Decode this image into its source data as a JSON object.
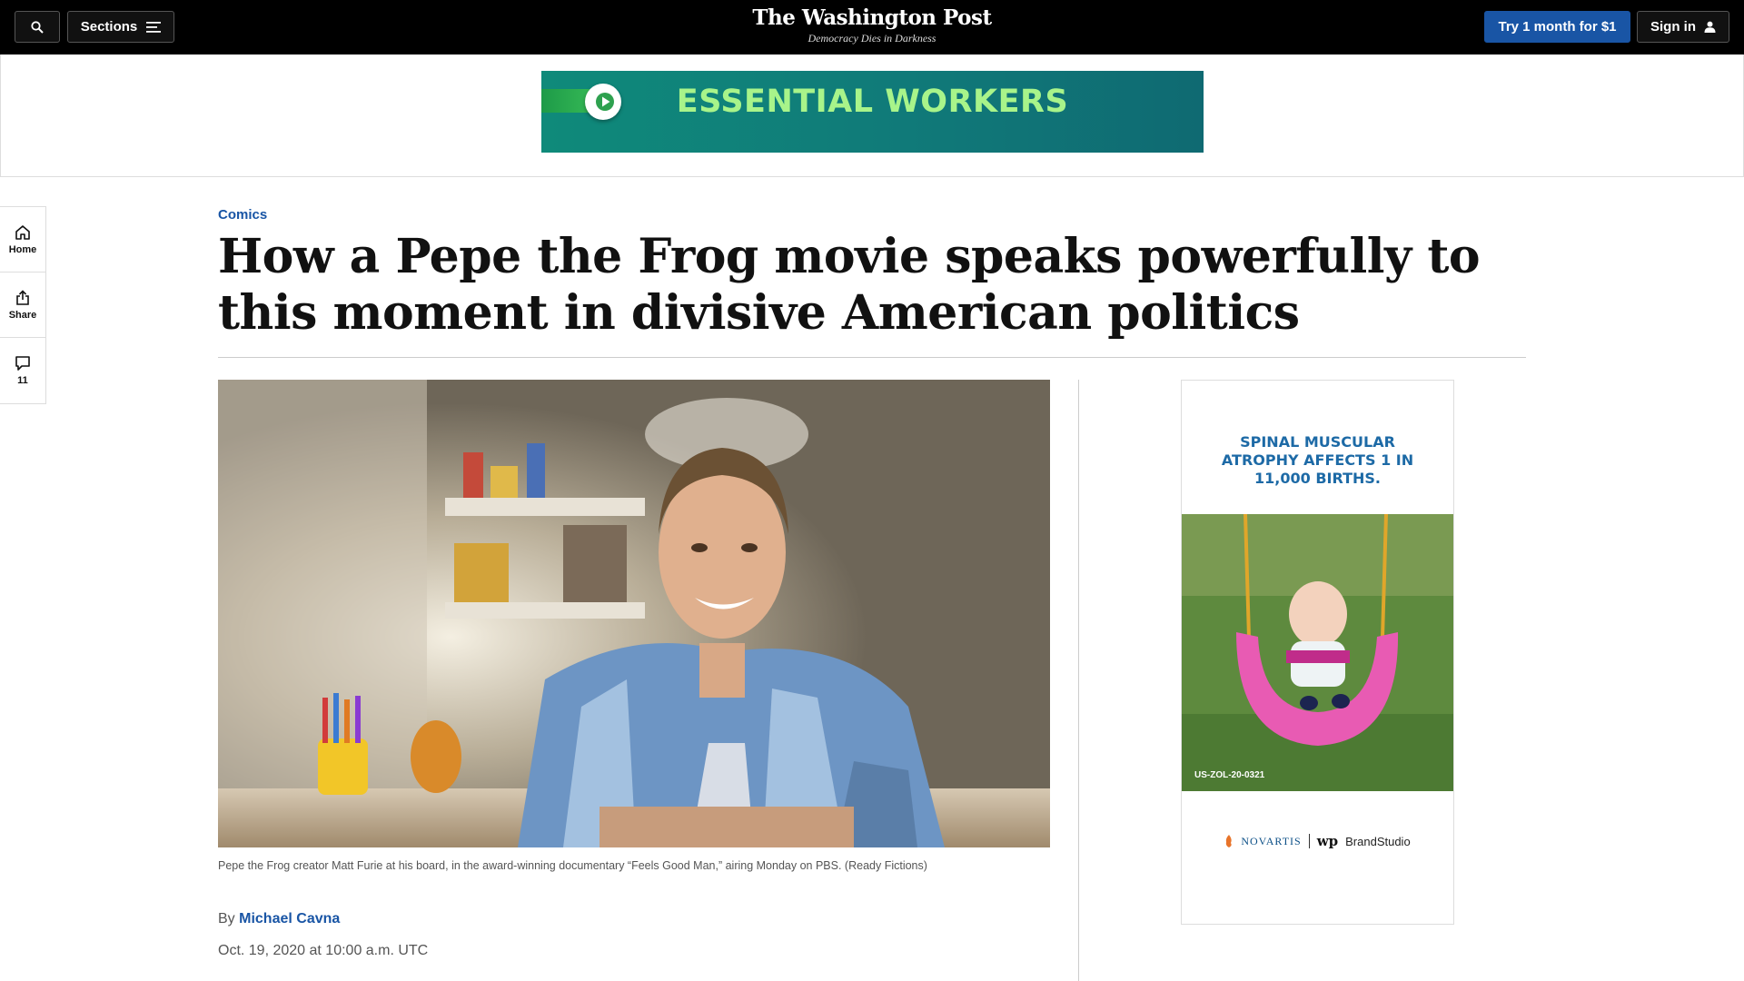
{
  "nav": {
    "sections_label": "Sections",
    "logo": "The Washington Post",
    "tagline": "Democracy Dies in Darkness",
    "subscribe_label": "Try 1 month for $1",
    "signin_label": "Sign in"
  },
  "top_ad": {
    "text": "ESSENTIAL WORKERS"
  },
  "left_rail": {
    "home_label": "Home",
    "share_label": "Share",
    "comments_count": "11"
  },
  "article": {
    "kicker": "Comics",
    "headline": "How a Pepe the Frog movie speaks powerfully to this moment in divisive American politics",
    "caption": "Pepe the Frog creator Matt Furie at his board, in the award-winning documentary “Feels Good Man,” airing Monday on PBS. (Ready Fictions)",
    "byline_prefix": "By",
    "author": "Michael Cavna",
    "date": "Oct. 19, 2020 at 10:00 a.m. UTC"
  },
  "side_ad": {
    "headline_line1": "SPINAL MUSCULAR",
    "headline_line2": "ATROPHY AFFECTS 1 IN",
    "headline_line3": "11,000 BIRTHS.",
    "code": "US-ZOL-20-0321",
    "brand1": "NOVARTIS",
    "brand2": "BrandStudio",
    "brand2_mark": "wp"
  },
  "colors": {
    "accent_blue": "#1955a5",
    "nav_bg": "#000000"
  }
}
